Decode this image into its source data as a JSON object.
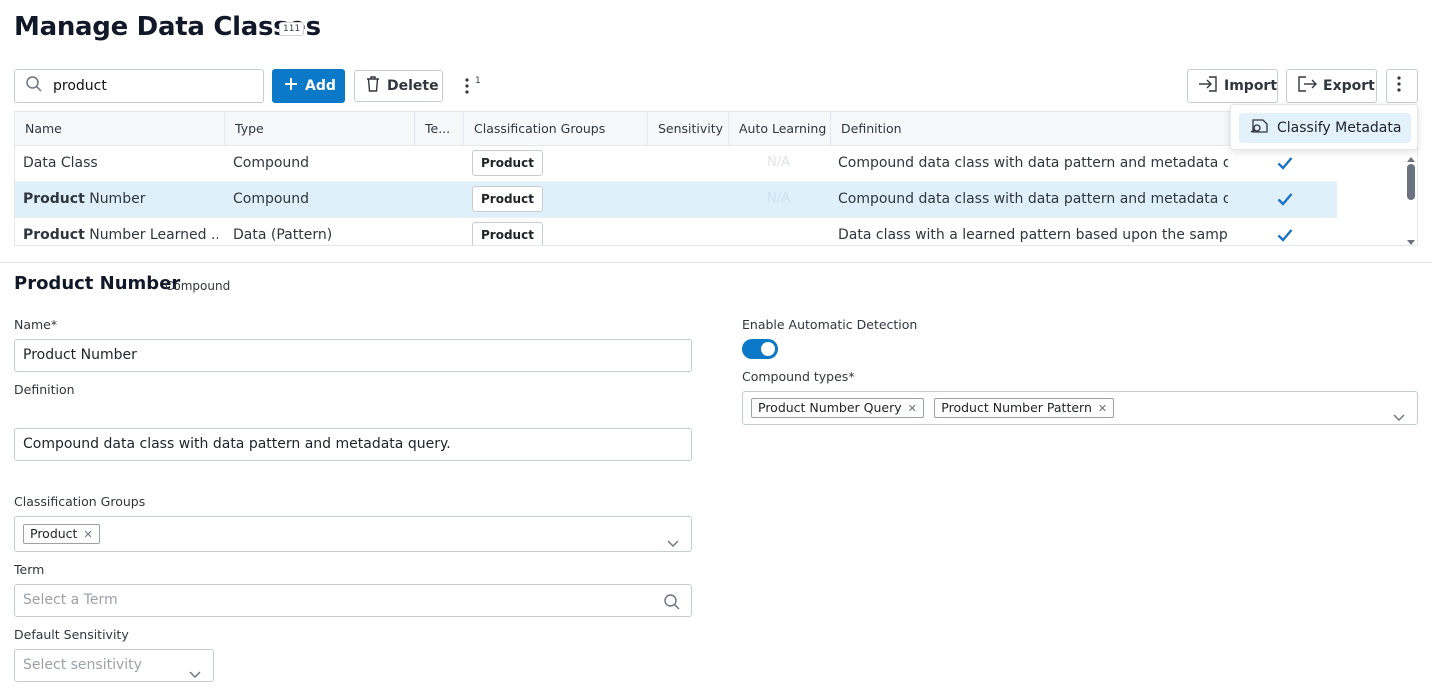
{
  "header": {
    "title": "Manage Data Classes",
    "count": "111"
  },
  "toolbar": {
    "search_value": "product",
    "add_label": "Add",
    "delete_label": "Delete",
    "more_badge": "1",
    "import_label": "Import",
    "export_label": "Export"
  },
  "menu": {
    "classify_label": "Classify Metadata"
  },
  "table": {
    "columns": [
      "Name",
      "Type",
      "Te...",
      "Classification Groups",
      "Sensitivity",
      "Auto Learning",
      "Definition"
    ],
    "rows": [
      {
        "name_bold": "",
        "name_rest": "Data Class",
        "type": "Compound",
        "group": "Product",
        "auto_learning": "N/A",
        "definition": "Compound data class with data pattern and metadata q...",
        "selected": false
      },
      {
        "name_bold": "Product",
        "name_rest": " Number",
        "type": "Compound",
        "group": "Product",
        "auto_learning": "N/A",
        "definition": "Compound data class with data pattern and metadata q...",
        "selected": true
      },
      {
        "name_bold": "Product",
        "name_rest": " Number Learned ...",
        "type": "Data (Pattern)",
        "group": "Product",
        "auto_learning": "",
        "definition": "Data class with a learned pattern based upon the sampli...",
        "selected": false
      }
    ]
  },
  "detail": {
    "title": "Product Number",
    "type": "Compound",
    "name_label": "Name*",
    "name_value": "Product Number",
    "definition_label": "Definition",
    "definition_value": "Compound data class with data pattern and metadata query.",
    "groups_label": "Classification Groups",
    "groups_tag": "Product",
    "term_label": "Term",
    "term_placeholder": "Select a Term",
    "sensitivity_label": "Default Sensitivity",
    "sensitivity_placeholder": "Select sensitivity",
    "auto_detect_label": "Enable Automatic Detection",
    "auto_detect_on": true,
    "compound_types_label": "Compound types*",
    "compound_types": [
      "Product Number Query",
      "Product Number Pattern"
    ]
  },
  "colors": {
    "accent": "#0b78c8",
    "selected_row": "#dff0fb",
    "check": "#1a73c2"
  }
}
